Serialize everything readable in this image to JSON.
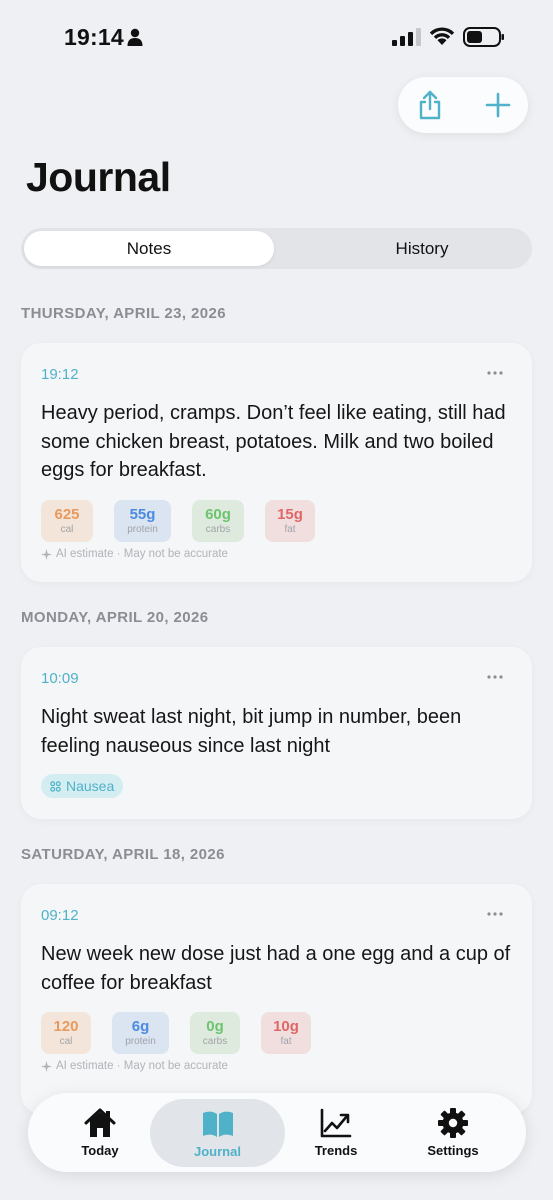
{
  "status_bar": {
    "time": "19:14"
  },
  "header": {
    "title": "Journal"
  },
  "segmented": {
    "tabs": [
      "Notes",
      "History"
    ],
    "selected": "Notes"
  },
  "entries": [
    {
      "date": "THURSDAY, APRIL 23, 2026",
      "time": "19:12",
      "text": "Heavy period, cramps. Don’t feel like eating, still had some chicken breast, potatoes. Milk and two boiled eggs for breakfast.",
      "macros": [
        {
          "value": "625",
          "label": "cal"
        },
        {
          "value": "55g",
          "label": "protein"
        },
        {
          "value": "60g",
          "label": "carbs"
        },
        {
          "value": "15g",
          "label": "fat"
        }
      ],
      "ai_note": "AI estimate · May not be accurate"
    },
    {
      "date": "MONDAY, APRIL 20, 2026",
      "time": "10:09",
      "text": "Night sweat last night, bit jump in number, been feeling nauseous since last night",
      "tag": "Nausea"
    },
    {
      "date": "SATURDAY, APRIL 18, 2026",
      "time": "09:12",
      "text": "New week new dose just had a one egg and a cup of coffee for breakfast",
      "macros": [
        {
          "value": "120",
          "label": "cal"
        },
        {
          "value": "6g",
          "label": "protein"
        },
        {
          "value": "0g",
          "label": "carbs"
        },
        {
          "value": "10g",
          "label": "fat"
        }
      ],
      "ai_note": "AI estimate · May not be accurate"
    }
  ],
  "tab_bar": {
    "items": [
      {
        "label": "Today",
        "icon": "house-icon"
      },
      {
        "label": "Journal",
        "icon": "book-icon"
      },
      {
        "label": "Trends",
        "icon": "trend-chart-icon"
      },
      {
        "label": "Settings",
        "icon": "gear-icon"
      }
    ],
    "selected": "Journal"
  },
  "colors": {
    "accent": "#4fb2c9",
    "cal": "#e79a5f",
    "protein": "#4b8be0",
    "carbs": "#6cc46e",
    "fat": "#e06767"
  }
}
